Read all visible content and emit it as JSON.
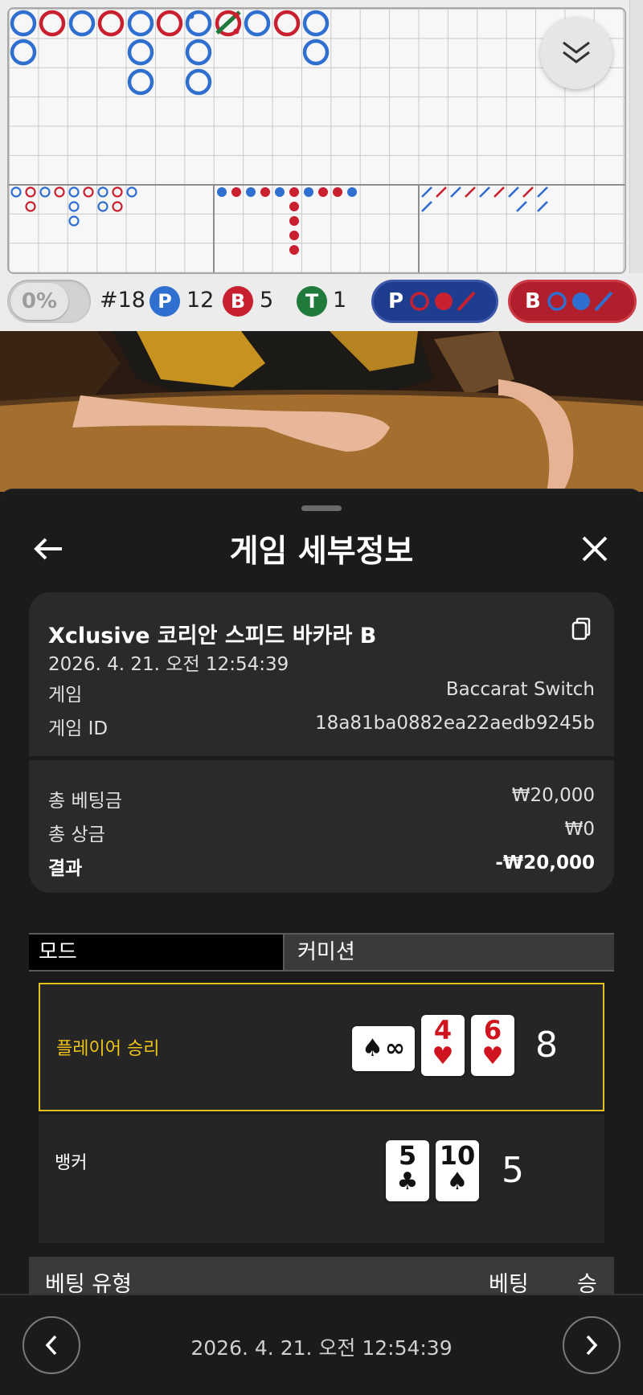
{
  "roadmap": {
    "cut_percent": "0%",
    "round_label": "#18",
    "player": {
      "letter": "P",
      "count": "12"
    },
    "banker": {
      "letter": "B",
      "count": "5"
    },
    "tie": {
      "letter": "T",
      "count": "1"
    },
    "predict_player": {
      "letter": "P"
    },
    "predict_banker": {
      "letter": "B"
    },
    "colors": {
      "player": "#2f6fd0",
      "banker": "#c9202f",
      "tie": "#1f7a3b"
    }
  },
  "panel": {
    "title": "게임 세부정보",
    "back_icon": "arrow-left-icon",
    "close_icon": "close-icon"
  },
  "game": {
    "name": "Xclusive 코리안 스피드 바카라 B",
    "date": "2026. 4. 21. 오전 12:54:39",
    "type_label": "게임",
    "type_value": "Baccarat Switch",
    "id_label": "게임 ID",
    "id_value": "18a81ba0882ea22aedb9245b"
  },
  "totals": {
    "bet_label": "총 베팅금",
    "bet_value": "₩20,000",
    "win_label": "총 상금",
    "win_value": "₩0",
    "result_label": "결과",
    "result_value": "-₩20,000"
  },
  "mode": {
    "label": "모드",
    "value": "커미션"
  },
  "hands": {
    "player": {
      "label": "플레이어 승리",
      "side_card": {
        "rank": "∞",
        "suit": "♠"
      },
      "cards": [
        {
          "rank": "4",
          "suit": "♥"
        },
        {
          "rank": "6",
          "suit": "♥"
        }
      ],
      "score": "8",
      "highlight_color": "#e1c21e"
    },
    "banker": {
      "label": "뱅커",
      "cards": [
        {
          "rank": "5",
          "suit": "♣"
        },
        {
          "rank": "10",
          "suit": "♠"
        }
      ],
      "score": "5"
    }
  },
  "bet_table": {
    "col_type": "베팅 유형",
    "col_bet": "베팅",
    "col_win": "승"
  },
  "footer": {
    "date": "2026. 4. 21. 오전 12:54:39",
    "prev_icon": "chevron-left-icon",
    "next_icon": "chevron-right-icon"
  }
}
